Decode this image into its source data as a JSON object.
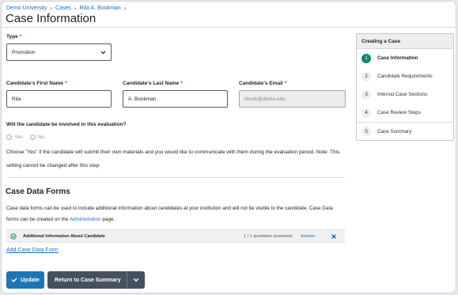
{
  "breadcrumb": [
    "Demo University",
    "Cases",
    "Rita A. Bookman"
  ],
  "page_title": "Case Information",
  "type_field": {
    "label": "Type",
    "value": "Promotion"
  },
  "first_name": {
    "label": "Candidate's First Name",
    "value": "Rita"
  },
  "last_name": {
    "label": "Candidate's Last Name",
    "value": "A. Bookman"
  },
  "email": {
    "label": "Candidate's Email",
    "placeholder": "rbook@demo.edu"
  },
  "involvement": {
    "question": "Will the candidate be involved in this evaluation?",
    "yes_label": "Yes",
    "no_label": "No",
    "help_text": "Choose \"Yes\" if the candidate will submit their own materials and you would like to communicate with them during the evaluation period. Note: This setting cannot be changed after this step."
  },
  "case_data_forms": {
    "title": "Case Data Forms",
    "desc_before": "Case data forms can be used to include additional information about candidates at your institution and will not be visible to the candidate. Case Data forms can be created on the ",
    "desc_link": "Administration",
    "desc_after": " page.",
    "forms": [
      {
        "name": "Additional Information About Candidate",
        "status": "1 / 1 questions answered",
        "action": "Answer"
      }
    ],
    "add_label": "Add Case Data Form"
  },
  "buttons": {
    "update": "Update",
    "return": "Return to Case Summary"
  },
  "steps": {
    "title": "Creating a Case",
    "items": [
      {
        "num": "1",
        "label": "Case Information"
      },
      {
        "num": "2",
        "label": "Candidate Requirements"
      },
      {
        "num": "3",
        "label": "Internal Case Sections"
      },
      {
        "num": "4",
        "label": "Case Review Steps"
      },
      {
        "num": "5",
        "label": "Case Summary"
      }
    ]
  },
  "colors": {
    "link": "#1e6fb5",
    "primary": "#1f74b6",
    "secondary": "#45515f",
    "step_active": "#12856f",
    "required": "#d02020"
  },
  "icons": [
    "chevron-right-icon",
    "chevron-down-icon",
    "check-circle-icon",
    "close-icon",
    "check-icon"
  ]
}
